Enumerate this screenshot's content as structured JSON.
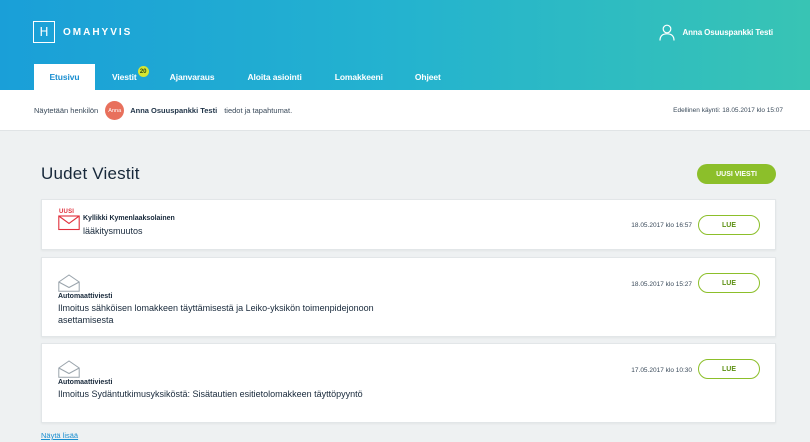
{
  "header": {
    "logo_text": "OMAHYVIS",
    "logo_letter": "H",
    "user_name": "Anna Osuuspankki Testi"
  },
  "tabs": [
    {
      "label": "Etusivu",
      "active": true
    },
    {
      "label": "Viestit",
      "badge": "20"
    },
    {
      "label": "Ajanvaraus"
    },
    {
      "label": "Aloita asiointi"
    },
    {
      "label": "Lomakkeeni"
    },
    {
      "label": "Ohjeet"
    }
  ],
  "infobar": {
    "prefix": "Näytetään henkilön",
    "avatar_initials": "Anna",
    "person_name": "Anna Osuuspankki Testi",
    "suffix": "tiedot ja tapahtumat.",
    "last_visit": "Edellinen käynti: 18.05.2017 klo 15:07"
  },
  "main": {
    "title": "Uudet Viestit",
    "new_message_label": "UUSI VIESTI",
    "show_more": "Näytä lisää"
  },
  "messages": [
    {
      "new_tag": "UUSI",
      "sender": "Kyllikki Kymenlaaksolainen",
      "subject": "lääkitysmuutos",
      "date": "18.05.2017 klo 16:57",
      "action": "LUE"
    },
    {
      "sender": "Automaattiviesti",
      "subject": "Ilmoitus sähköisen lomakkeen täyttämisestä ja Leiko-yksikön toimenpidejonoon asettamisesta",
      "date": "18.05.2017 klo 15:27",
      "action": "LUE"
    },
    {
      "sender": "Automaattiviesti",
      "subject": "Ilmoitus Sydäntutkimusyksiköstä: Sisätautien esitietolomakkeen täyttöpyyntö",
      "date": "17.05.2017 klo 10:30",
      "action": "LUE"
    }
  ],
  "colors": {
    "header_gradient_start": "#1a9fd8",
    "header_gradient_end": "#38c4b4",
    "accent_green": "#8cbf2a",
    "new_red": "#e0303c",
    "link_blue": "#1a8ed0",
    "badge_yellow": "#d6e632"
  }
}
